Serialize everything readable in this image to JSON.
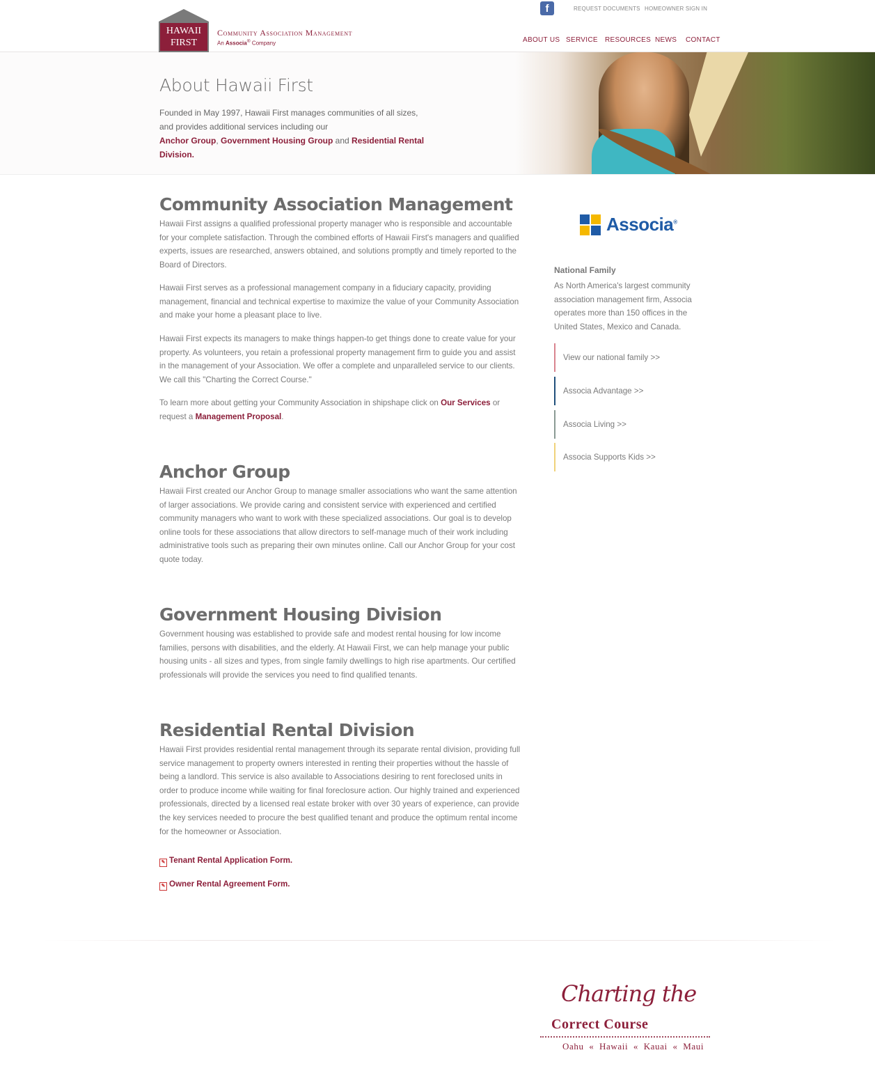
{
  "header": {
    "logo_line1": "HAWAII",
    "logo_line2": "FIRST",
    "tagline": "Community Association Management",
    "subtagline_prefix": "An ",
    "subtagline_brand": "Associa",
    "subtagline_reg": "®",
    "subtagline_suffix": " Company",
    "facebook_icon": "facebook-icon",
    "util_links": [
      "REQUEST DOCUMENTS",
      "HOMEOWNER SIGN IN"
    ],
    "nav": [
      "ABOUT US",
      "SERVICE",
      "RESOURCES",
      "NEWS",
      "CONTACT"
    ]
  },
  "hero": {
    "title": "About Hawaii First",
    "line1": "Founded in May 1997, Hawaii First manages communities of all sizes,",
    "line2": "and provides additional services including our",
    "link1": "Anchor Group",
    "sep1": ", ",
    "link2": "Government Housing Group",
    "sep2": " and ",
    "link3": "Residential Rental Division."
  },
  "sections": {
    "cam": {
      "title": "Community Association Management",
      "p1": "Hawaii First assigns a qualified professional property manager who is responsible and accountable for your complete satisfaction.  Through the combined efforts of Hawaii First's managers and qualified experts, issues are researched, answers obtained, and solutions promptly and timely reported to the Board of Directors.",
      "p2": "Hawaii First serves as a professional management company in a fiduciary capacity, providing management, financial and technical expertise to maximize the value of your Community Association and make your home a pleasant place to live.",
      "p3": "Hawaii First expects its managers to make things happen-to get things done to create value for your property. As volunteers, you retain a professional property management firm to guide you and assist in the management of your Association.  We offer a complete and unparalleled service to our clients. We call this \"Charting the Correct Course.\"",
      "p4_start": "To learn more about getting your Community Association in shipshape click on ",
      "p4_link1": "Our Services",
      "p4_mid": " or request a ",
      "p4_link2": "Management Proposal",
      "p4_end": "."
    },
    "anchor": {
      "title": "Anchor Group",
      "p1": "Hawaii First created our Anchor Group to manage smaller associations who want the same attention of larger associations.  We provide caring and consistent service with experienced and certified community managers who want to work with these specialized associations. Our goal is to develop online tools for these associations that allow directors to self-manage much of their work including administrative tools such as preparing their own minutes online. Call our Anchor Group for your cost quote today."
    },
    "gov": {
      "title": "Government Housing Division",
      "p1": "Government housing was established to provide safe and modest rental housing for low income families, persons with disabilities, and the elderly. At Hawaii First, we can help manage your public housing units - all sizes and types, from single family dwellings to high rise apartments. Our certified professionals will provide the services you need to find qualified tenants."
    },
    "rental": {
      "title": "Residential Rental Division",
      "p1": "Hawaii First provides residential rental management through its separate rental division, providing full service management to property owners interested in renting their properties without the hassle of being a landlord. This service is also available to Associations desiring to rent foreclosed units in order to produce income while waiting for final foreclosure action. Our highly trained and experienced professionals, directed by a licensed real estate broker with over 30 years of experience, can provide the key services needed to procure the best qualified tenant and produce the optimum rental income for the homeowner or Association.",
      "form1": "Tenant Rental Application Form.",
      "form2": "Owner Rental Agreement Form."
    }
  },
  "sidebar": {
    "logo_text": "Associa",
    "logo_reg": "®",
    "heading": "National Family",
    "text": "As North America's largest community association management firm, Associa operates more than 150 offices in the United States, Mexico and Canada.",
    "links": [
      {
        "label": "View our national family >>",
        "color": "#d9848f"
      },
      {
        "label": "Associa Advantage >>",
        "color": "#1f4f7a"
      },
      {
        "label": "Associa Living >>",
        "color": "#8a9a94"
      },
      {
        "label": "Associa Supports Kids >>",
        "color": "#f0d27a"
      }
    ]
  },
  "footer": {
    "script": "Charting the",
    "bold": "Correct Course",
    "islands": "Oahu  «  Hawaii  «  Kauai  «  Maui"
  },
  "colors": {
    "brand": "#8c1f3a",
    "associa_blue": "#1f5ba6",
    "associa_yellow": "#f5b800"
  }
}
